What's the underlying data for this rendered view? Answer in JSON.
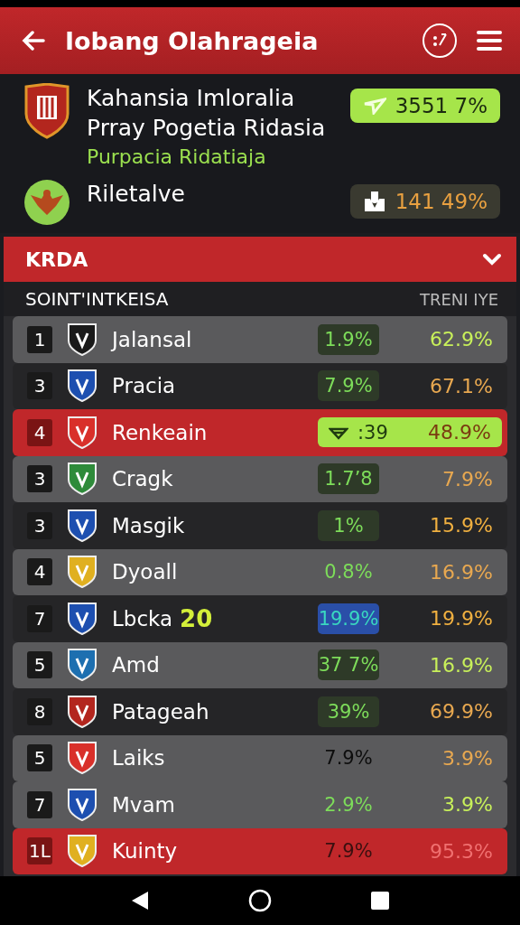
{
  "app_bar": {
    "title": "Iobang Olahrageia"
  },
  "summary": [
    {
      "name_lines": [
        "Kahansia Imloralia",
        "Prray Pogetia Ridasia"
      ],
      "subtitle": "Purpacia Ridatiaja",
      "stat": "3551 7%",
      "kind": "green",
      "color": "#b3261e"
    },
    {
      "name_lines": [
        "Riletalve"
      ],
      "stat": "141 49%",
      "kind": "dark",
      "color": "#8fd14f"
    }
  ],
  "section": {
    "title": "KRDA",
    "expanded": true,
    "column_1": "SOINT'INTKEISA",
    "column_2": "TRENI IYE"
  },
  "rows": [
    {
      "rank": "1",
      "team": "Jalansal",
      "color": "#1a1a1a",
      "kind": "light",
      "change": {
        "text": "1.9%",
        "color": "#7ddc5a",
        "kind": "boxed"
      },
      "value": {
        "text": "62.9%",
        "color": "#c8f05a"
      }
    },
    {
      "rank": "3",
      "team": "Pracia",
      "color": "#1d4fb0",
      "kind": "dark",
      "change": {
        "text": "7.9%",
        "color": "#7ddc5a",
        "kind": "boxed"
      },
      "value": {
        "text": "67.1%",
        "color": "#e8a850"
      }
    },
    {
      "rank": "4",
      "team": "Renkeain",
      "color": "#d9302a",
      "kind": "featured",
      "change": {
        "text": ":39",
        "color": "#1f3a10"
      },
      "value": {
        "text": "48.9%",
        "color": "#7a3a10"
      }
    },
    {
      "rank": "3",
      "team": "Cragk",
      "color": "#2e8b3a",
      "kind": "light",
      "change": {
        "text": "1.7’8",
        "color": "#7ddc5a",
        "kind": "boxed"
      },
      "value": {
        "text": "7.9%",
        "color": "#e8a850"
      }
    },
    {
      "rank": "3",
      "team": "Masgik",
      "color": "#1d4fb0",
      "kind": "dark",
      "change": {
        "text": "1%",
        "color": "#7ddc5a",
        "kind": "boxed"
      },
      "value": {
        "text": "15.9%",
        "color": "#f0b040"
      }
    },
    {
      "rank": "4",
      "team": "Dyoall",
      "color": "#e0b020",
      "kind": "light",
      "change": {
        "text": "0.8%",
        "color": "#7ddc5a",
        "kind": "plain"
      },
      "value": {
        "text": "16.9%",
        "color": "#e8a850"
      }
    },
    {
      "rank": "7",
      "team": "Lbcka",
      "badge": "20",
      "color": "#1d4fb0",
      "kind": "dark",
      "change": {
        "text": "19.9%",
        "color": "#3ad8c0",
        "kind": "accent"
      },
      "value": {
        "text": "19.9%",
        "color": "#f0b040"
      }
    },
    {
      "rank": "5",
      "team": "Amd",
      "color": "#1d6fb0",
      "kind": "light",
      "change": {
        "text": "37 7%",
        "color": "#7ddc5a",
        "kind": "boxed"
      },
      "value": {
        "text": "16.9%",
        "color": "#c8f05a"
      }
    },
    {
      "rank": "8",
      "team": "Patageah",
      "color": "#b3261e",
      "kind": "dark",
      "change": {
        "text": "39%",
        "color": "#7ddc5a",
        "kind": "boxed"
      },
      "value": {
        "text": "69.9%",
        "color": "#e8a850"
      }
    },
    {
      "rank": "5",
      "team": "Laiks",
      "color": "#d9302a",
      "kind": "light",
      "change": {
        "text": "7.9%",
        "color": "#0d0d0d",
        "kind": "plain"
      },
      "value": {
        "text": "3.9%",
        "color": "#e8a850"
      }
    },
    {
      "rank": "7",
      "team": "Mvam",
      "color": "#1d4fb0",
      "kind": "light",
      "change": {
        "text": "2.9%",
        "color": "#7ddc5a",
        "kind": "plain"
      },
      "value": {
        "text": "3.9%",
        "color": "#c8f05a"
      }
    },
    {
      "rank": "1L",
      "team": "Kuinty",
      "color": "#e0b020",
      "kind": "highlighted",
      "change": {
        "text": "7.9%",
        "color": "#3a1010",
        "kind": "plain"
      },
      "value": {
        "text": "95.3%",
        "color": "#f07070"
      }
    }
  ]
}
